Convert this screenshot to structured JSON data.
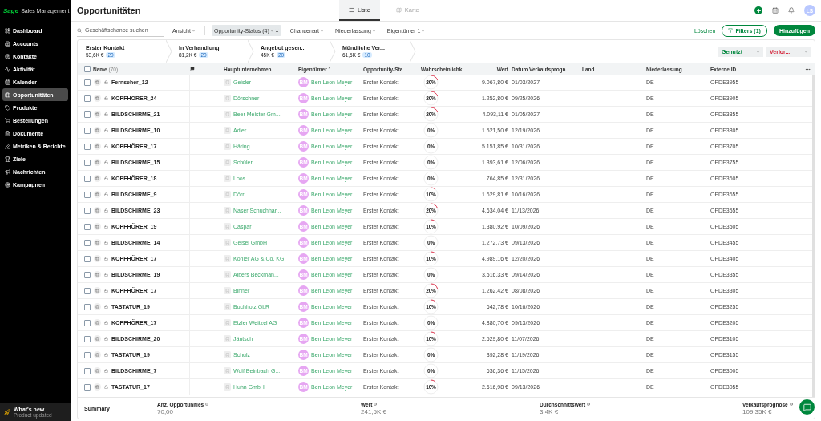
{
  "app": {
    "logo": "Sage",
    "product": "Sales Management"
  },
  "sidebar": {
    "items": [
      {
        "label": "Dashboard",
        "selected": false
      },
      {
        "label": "Accounts",
        "selected": false
      },
      {
        "label": "Kontakte",
        "selected": false
      },
      {
        "label": "Aktivität",
        "selected": false
      },
      {
        "label": "Kalender",
        "selected": false
      },
      {
        "label": "Opportunitäten",
        "selected": true
      },
      {
        "label": "Produkte",
        "selected": false
      },
      {
        "label": "Bestellungen",
        "selected": false
      },
      {
        "label": "Dokumente",
        "selected": false
      },
      {
        "label": "Metriken & Berichte",
        "selected": false
      },
      {
        "label": "Ziele",
        "selected": false
      },
      {
        "label": "Nachrichten",
        "selected": false
      },
      {
        "label": "Kampagnen",
        "selected": false
      }
    ],
    "footer": {
      "title": "What's new",
      "subtitle": "Product updated"
    }
  },
  "header": {
    "title": "Opportunitäten",
    "tabs": [
      {
        "label": "Liste",
        "selected": true
      },
      {
        "label": "Karte",
        "selected": false
      }
    ],
    "avatar": "LS"
  },
  "filters": {
    "search": {
      "placeholder": "Geschäftschance suchen"
    },
    "view": "Ansicht",
    "chips": [
      {
        "label": "Opportunity-Status (4)",
        "active": true
      },
      {
        "label": "Chancenart",
        "active": false
      },
      {
        "label": "Niederlassung",
        "active": false
      },
      {
        "label": "Eigentümer 1",
        "active": false
      }
    ],
    "clear": "Löschen",
    "filters_button": "Filters (1)",
    "add_button": "Hinzufügen"
  },
  "pipeline": {
    "stages": [
      {
        "name": "Erster Kontakt",
        "amount": "53,6K €",
        "count": "20"
      },
      {
        "name": "In Verhandlung",
        "amount": "81,2K €",
        "count": "20"
      },
      {
        "name": "Angebot gesen...",
        "amount": "45K €",
        "count": "20"
      },
      {
        "name": "Mündliche Ver...",
        "amount": "61,5K €",
        "count": "10"
      }
    ],
    "selectors": [
      {
        "label": "Genutzt",
        "kind": "won"
      },
      {
        "label": "Verlor...",
        "kind": "lost"
      }
    ]
  },
  "table": {
    "all_checked": false,
    "columns": [
      {
        "label": "Name",
        "count": "(70)",
        "kind": "name"
      },
      {
        "kind": "flag"
      },
      {
        "label": "Hauptunternehmen",
        "kind": "text"
      },
      {
        "label": "Eigentümer 1",
        "kind": "text"
      },
      {
        "label": "Opportunity-Sta...",
        "kind": "text"
      },
      {
        "label": "Wahrscheinlichk...",
        "kind": "text"
      },
      {
        "label": "Wert",
        "kind": "number"
      },
      {
        "label": "Datum Verkaufsprogn...",
        "kind": "text"
      },
      {
        "label": "Land",
        "kind": "text"
      },
      {
        "label": "Niederlassung",
        "kind": "text"
      },
      {
        "label": "Externe ID",
        "kind": "text"
      }
    ],
    "rows": [
      {
        "checked": false,
        "name": "Fernseher_12",
        "company": "Geisler",
        "owner": "Ben Leon Meyer",
        "initials": "BM",
        "status": "Erster Kontakt",
        "probability": "20%",
        "value": "9.067,80 €",
        "date": "01/03/2027",
        "branch": "DE",
        "external_id": "OPDE3955"
      },
      {
        "checked": false,
        "name": "KOPFHÖRER_24",
        "company": "Dörschner",
        "owner": "Ben Leon Meyer",
        "initials": "BM",
        "status": "Erster Kontakt",
        "probability": "20%",
        "value": "1.252,80 €",
        "date": "09/25/2026",
        "branch": "DE",
        "external_id": "OPDE3905"
      },
      {
        "checked": false,
        "name": "BILDSCHIRME_21",
        "company": "Beer Meister Gm...",
        "owner": "Ben Leon Meyer",
        "initials": "BM",
        "status": "Erster Kontakt",
        "probability": "20%",
        "value": "4.093,11 €",
        "date": "01/05/2027",
        "branch": "DE",
        "external_id": "OPDE3855"
      },
      {
        "checked": false,
        "name": "BILDSCHIRME_10",
        "company": "Adler",
        "owner": "Ben Leon Meyer",
        "initials": "BM",
        "status": "Erster Kontakt",
        "probability": "0%",
        "value": "1.521,50 €",
        "date": "12/19/2026",
        "branch": "DE",
        "external_id": "OPDE3805"
      },
      {
        "checked": false,
        "name": "KOPFHÖRER_17",
        "company": "Häring",
        "owner": "Ben Leon Meyer",
        "initials": "BM",
        "status": "Erster Kontakt",
        "probability": "0%",
        "value": "5.151,85 €",
        "date": "10/31/2026",
        "branch": "DE",
        "external_id": "OPDE3705"
      },
      {
        "checked": false,
        "name": "BILDSCHIRME_15",
        "company": "Schüler",
        "owner": "Ben Leon Meyer",
        "initials": "BM",
        "status": "Erster Kontakt",
        "probability": "0%",
        "value": "1.393,61 €",
        "date": "12/06/2026",
        "branch": "DE",
        "external_id": "OPDE3755"
      },
      {
        "checked": false,
        "name": "KOPFHÖRER_18",
        "company": "Loos",
        "owner": "Ben Leon Meyer",
        "initials": "BM",
        "status": "Erster Kontakt",
        "probability": "0%",
        "value": "764,85 €",
        "date": "12/31/2026",
        "branch": "DE",
        "external_id": "OPDE3605"
      },
      {
        "checked": false,
        "name": "BILDSCHIRME_9",
        "company": "Dörr",
        "owner": "Ben Leon Meyer",
        "initials": "BM",
        "status": "Erster Kontakt",
        "probability": "10%",
        "value": "1.629,81 €",
        "date": "10/16/2026",
        "branch": "DE",
        "external_id": "OPDE3655"
      },
      {
        "checked": false,
        "name": "BILDSCHIRME_23",
        "company": "Naser Schuchhar...",
        "owner": "Ben Leon Meyer",
        "initials": "BM",
        "status": "Erster Kontakt",
        "probability": "20%",
        "value": "4.634,04 €",
        "date": "11/13/2026",
        "branch": "DE",
        "external_id": "OPDE3555"
      },
      {
        "checked": false,
        "name": "KOPFHÖRER_19",
        "company": "Caspar",
        "owner": "Ben Leon Meyer",
        "initials": "BM",
        "status": "Erster Kontakt",
        "probability": "10%",
        "value": "1.380,92 €",
        "date": "10/09/2026",
        "branch": "DE",
        "external_id": "OPDE3505"
      },
      {
        "checked": false,
        "name": "BILDSCHIRME_14",
        "company": "Geisel GmbH",
        "owner": "Ben Leon Meyer",
        "initials": "BM",
        "status": "Erster Kontakt",
        "probability": "0%",
        "value": "1.272,73 €",
        "date": "09/13/2026",
        "branch": "DE",
        "external_id": "OPDE3455"
      },
      {
        "checked": false,
        "name": "KOPFHÖRER_17",
        "company": "Köhler AG & Co. KG",
        "owner": "Ben Leon Meyer",
        "initials": "BM",
        "status": "Erster Kontakt",
        "probability": "10%",
        "value": "4.989,16 €",
        "date": "12/20/2026",
        "branch": "DE",
        "external_id": "OPDE3405"
      },
      {
        "checked": false,
        "name": "BILDSCHIRME_19",
        "company": "Albers Beckman...",
        "owner": "Ben Leon Meyer",
        "initials": "BM",
        "status": "Erster Kontakt",
        "probability": "0%",
        "value": "3.516,33 €",
        "date": "09/14/2026",
        "branch": "DE",
        "external_id": "OPDE3355"
      },
      {
        "checked": false,
        "name": "KOPFHÖRER_17",
        "company": "Binner",
        "owner": "Ben Leon Meyer",
        "initials": "BM",
        "status": "Erster Kontakt",
        "probability": "20%",
        "value": "1.262,42 €",
        "date": "08/08/2026",
        "branch": "DE",
        "external_id": "OPDE3305"
      },
      {
        "checked": false,
        "name": "TASTATUR_19",
        "company": "Buchholz GbR",
        "owner": "Ben Leon Meyer",
        "initials": "BM",
        "status": "Erster Kontakt",
        "probability": "10%",
        "value": "642,78 €",
        "date": "10/16/2026",
        "branch": "DE",
        "external_id": "OPDE3255"
      },
      {
        "checked": false,
        "name": "KOPFHÖRER_17",
        "company": "Etzler Weitzel AG",
        "owner": "Ben Leon Meyer",
        "initials": "BM",
        "status": "Erster Kontakt",
        "probability": "0%",
        "value": "4.880,70 €",
        "date": "09/13/2026",
        "branch": "DE",
        "external_id": "OPDE3205"
      },
      {
        "checked": false,
        "name": "BILDSCHIRME_20",
        "company": "Jäntsch",
        "owner": "Ben Leon Meyer",
        "initials": "BM",
        "status": "Erster Kontakt",
        "probability": "10%",
        "value": "2.529,80 €",
        "date": "11/07/2026",
        "branch": "DE",
        "external_id": "OPDE3105"
      },
      {
        "checked": false,
        "name": "TASTATUR_19",
        "company": "Schulz",
        "owner": "Ben Leon Meyer",
        "initials": "BM",
        "status": "Erster Kontakt",
        "probability": "0%",
        "value": "392,28 €",
        "date": "11/19/2026",
        "branch": "DE",
        "external_id": "OPDE3155"
      },
      {
        "checked": false,
        "name": "BILDSCHIRME_7",
        "company": "Wolf Beinbach G...",
        "owner": "Ben Leon Meyer",
        "initials": "BM",
        "status": "Erster Kontakt",
        "probability": "0%",
        "value": "636,36 €",
        "date": "11/15/2026",
        "branch": "DE",
        "external_id": "OPDE3005"
      },
      {
        "checked": false,
        "name": "TASTATUR_17",
        "company": "Huhn GmbH",
        "owner": "Ben Leon Meyer",
        "initials": "BM",
        "status": "Erster Kontakt",
        "probability": "10%",
        "value": "2.616,98 €",
        "date": "09/13/2026",
        "branch": "DE",
        "external_id": "OPDE3055"
      }
    ]
  },
  "summary": {
    "label": "Summary",
    "metrics": [
      {
        "label": "Anz. Opportunities",
        "value": "70,00"
      },
      {
        "label": "Wert",
        "value": "241,5K €"
      },
      {
        "label": "Durchschnittswert",
        "value": "3,4K €"
      },
      {
        "label": "Verkaufsprognose",
        "value": "109,35K €"
      }
    ]
  }
}
